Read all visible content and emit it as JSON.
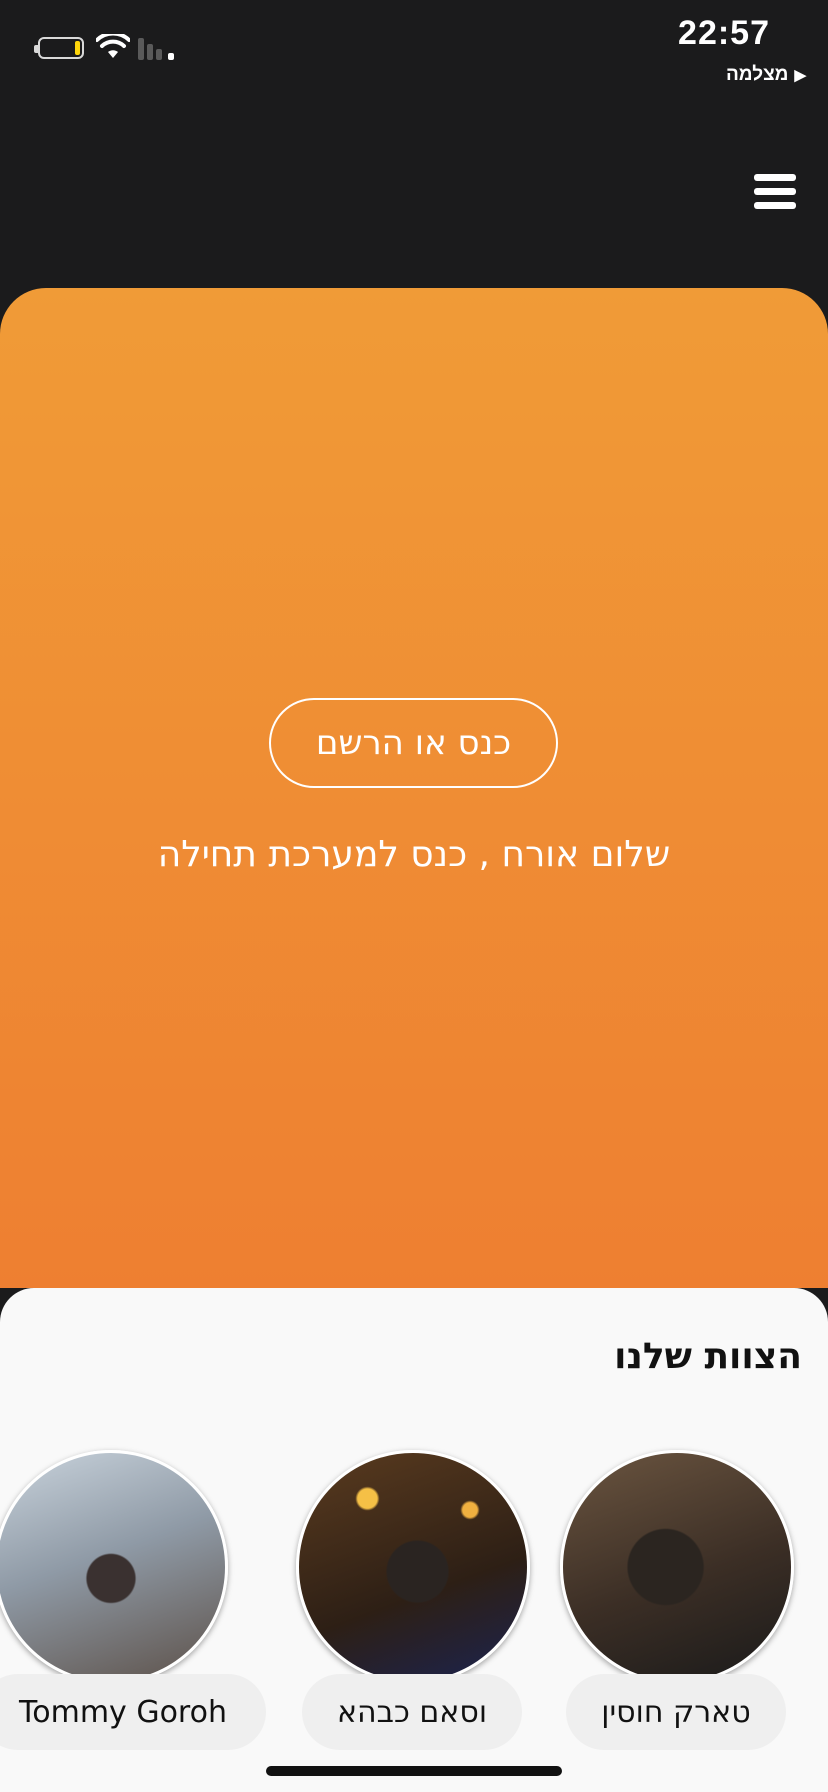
{
  "status_bar": {
    "time": "22:57",
    "back_app_label": "מצלמה",
    "back_arrow": "▶"
  },
  "header": {
    "menu_icon": "hamburger-menu-icon"
  },
  "hero": {
    "login_button_label": "כנס או הרשם",
    "greeting": "שלום אורח , כנס למערכת תחילה",
    "gradient_top": "#f09b37",
    "gradient_bottom": "#ee7f31"
  },
  "team": {
    "title": "הצוות שלנו",
    "members": [
      {
        "name": "טארק חוסין"
      },
      {
        "name": "וסאם כבהא"
      },
      {
        "name": "Tommy Goroh"
      }
    ]
  }
}
